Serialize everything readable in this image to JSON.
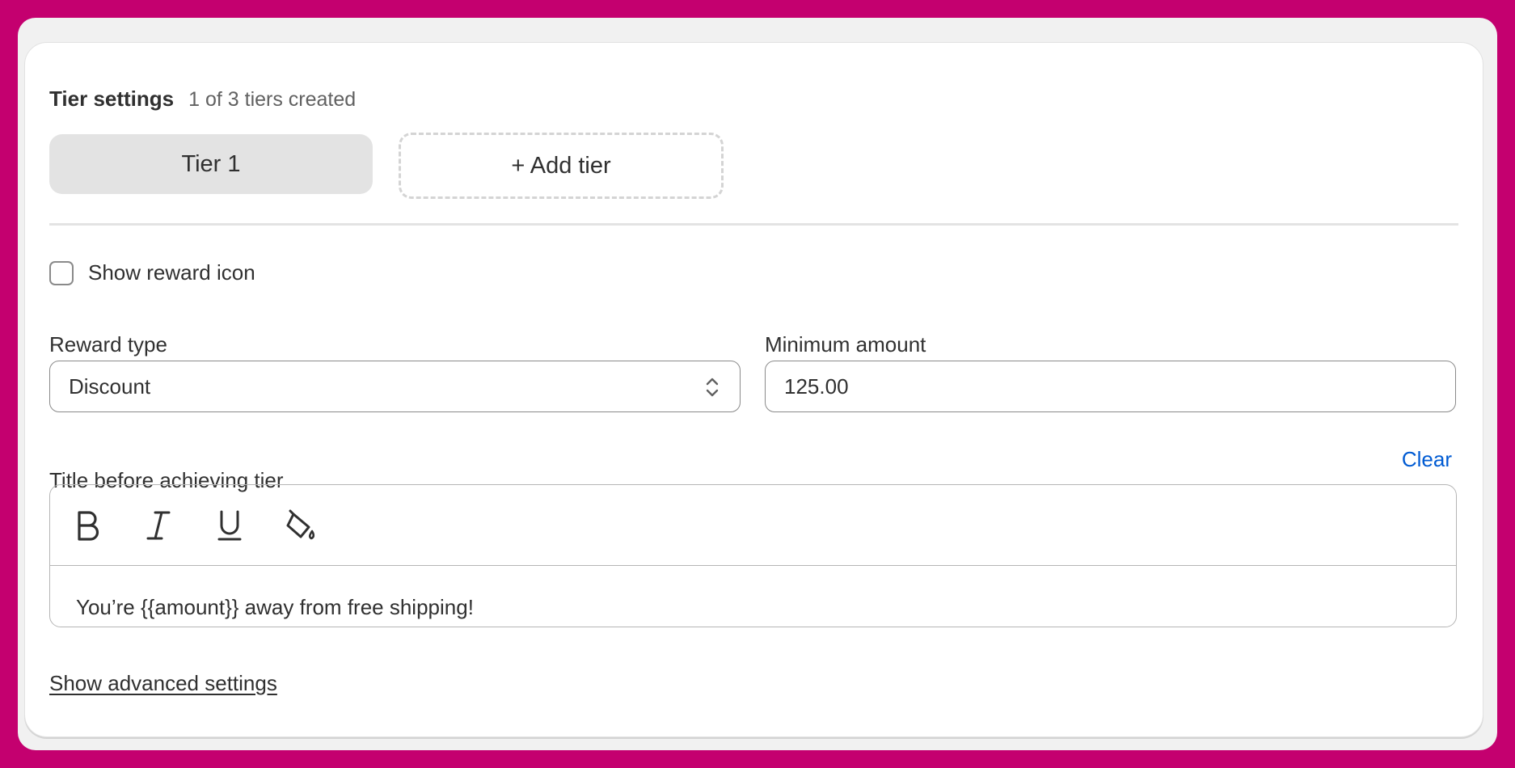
{
  "header": {
    "title": "Tier settings",
    "subtitle": "1 of 3 tiers created"
  },
  "tiers": {
    "tabs": [
      {
        "label": "Tier 1",
        "selected": true
      }
    ],
    "add_label": "+ Add tier"
  },
  "reward_icon": {
    "label": "Show reward icon",
    "checked": false
  },
  "reward_type": {
    "label": "Reward type",
    "value": "Discount"
  },
  "minimum_amount": {
    "label": "Minimum amount",
    "value": "125.00"
  },
  "title_before": {
    "label": "Title before achieving tier",
    "clear_label": "Clear",
    "toolbar": [
      "bold-icon",
      "italic-icon",
      "underline-icon",
      "paint-bucket-icon"
    ],
    "content": "You’re {{amount}} away from free shipping!"
  },
  "advanced": {
    "label": "Show advanced settings"
  },
  "colors": {
    "background": "#c4006f",
    "link": "#005bd3",
    "tab_selected": "#e3e3e3"
  }
}
